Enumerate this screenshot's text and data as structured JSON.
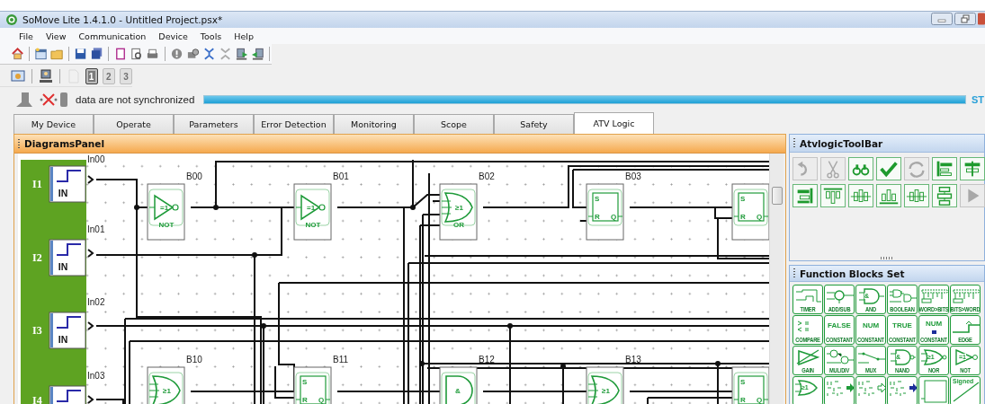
{
  "window": {
    "title": "SoMove Lite 1.4.1.0 - Untitled Project.psx*"
  },
  "menu": [
    "File",
    "View",
    "Communication",
    "Device",
    "Tools",
    "Help"
  ],
  "toolbar_2": [
    {
      "disabled": false
    },
    {
      "disabled": false
    },
    {
      "disabled": true
    },
    {
      "label": "1",
      "selected": true,
      "disabled": false
    },
    {
      "label": "2",
      "selected": false,
      "disabled": true
    },
    {
      "label": "3",
      "selected": false,
      "disabled": true
    }
  ],
  "sync": {
    "connected": false,
    "message": "data are not synchronized",
    "level": 1,
    "status": "ST"
  },
  "tabs": [
    {
      "label": "My Device",
      "selected": false
    },
    {
      "label": "Operate",
      "selected": false
    },
    {
      "label": "Parameters",
      "selected": false
    },
    {
      "label": "Error Detection",
      "selected": false
    },
    {
      "label": "Monitoring",
      "selected": false
    },
    {
      "label": "Scope",
      "selected": false
    },
    {
      "label": "Safety",
      "selected": false
    },
    {
      "label": "ATV Logic",
      "selected": true
    }
  ],
  "diagrams_panel": {
    "title": "DiagramsPanel",
    "inputs": [
      {
        "label": "I1",
        "block": "IN",
        "name": "In00"
      },
      {
        "label": "I2",
        "block": "IN",
        "name": "In01"
      },
      {
        "label": "I3",
        "block": "IN",
        "name": "In02"
      },
      {
        "label": "I4",
        "name": "In03"
      }
    ],
    "block_rows": [
      [
        {
          "id": "B00",
          "kind": "not",
          "symbol": "=1",
          "label": "NOT"
        },
        {
          "id": "B01",
          "kind": "not",
          "symbol": "=1",
          "label": "NOT"
        },
        {
          "id": "B02",
          "kind": "or",
          "symbol": "≥1",
          "label": "OR"
        },
        {
          "id": "B03",
          "kind": "sr",
          "set": "S",
          "reset": "R",
          "output": "Q"
        },
        {
          "kind": "sr",
          "set": "S",
          "reset": "R",
          "output": "Q"
        }
      ],
      [
        {
          "id": "B10",
          "kind": "or",
          "symbol": "≥1"
        },
        {
          "id": "B11",
          "kind": "sr",
          "set": "S",
          "reset": "R",
          "output": "Q"
        },
        {
          "id": "B12",
          "kind": "and",
          "symbol": "&"
        },
        {
          "id": "B13",
          "kind": "or",
          "symbol": "≥1"
        },
        {
          "kind": "sr",
          "set": "S",
          "reset": "R",
          "output": "Q"
        }
      ]
    ]
  },
  "toolbar_panel": {
    "title": "AtvlogicToolBar",
    "tools": [
      {
        "disabled": true
      },
      {
        "disabled": true
      },
      {
        "disabled": false
      },
      {
        "disabled": false
      },
      {
        "disabled": true
      },
      {
        "disabled": false
      },
      {
        "disabled": false
      },
      {
        "disabled": false
      },
      {
        "disabled": false
      },
      {
        "disabled": false
      },
      {
        "disabled": false
      },
      {
        "disabled": false
      },
      {
        "disabled": false
      },
      {
        "disabled": true
      }
    ]
  },
  "function_blocks": {
    "title": "Function Blocks Set",
    "blocks": [
      {
        "kind": "timer",
        "label": "TIMER"
      },
      {
        "kind": "addsub",
        "label": "ADD/SUB"
      },
      {
        "kind": "and",
        "label": "AND",
        "caption": "&"
      },
      {
        "kind": "boolean",
        "label": "BOOLEAN"
      },
      {
        "kind": "wordbits",
        "label": "WORD>BITS"
      },
      {
        "kind": "bitsword",
        "label": "BITS>WORD"
      },
      {
        "kind": "compare",
        "label": "COMPARE"
      },
      {
        "kind": "const",
        "label": "CONSTANT",
        "caption": "FALSE"
      },
      {
        "kind": "const",
        "label": "CONSTANT",
        "caption": "NUM"
      },
      {
        "kind": "const",
        "label": "CONSTANT",
        "caption": "TRUE"
      },
      {
        "kind": "constnum",
        "label": "CONSTANT",
        "caption": "NUM"
      },
      {
        "kind": "edge",
        "label": "EDGE"
      },
      {
        "kind": "gain",
        "label": "GAIN"
      },
      {
        "kind": "muldiv",
        "label": "MUL/DIV"
      },
      {
        "kind": "mux",
        "label": "MUX"
      },
      {
        "kind": "nand",
        "label": "NAND",
        "caption": "&"
      },
      {
        "kind": "nor",
        "label": "NOR",
        "caption": "≥1"
      },
      {
        "kind": "not",
        "label": "NOT",
        "caption": "=1"
      },
      {
        "kind": "or",
        "caption": "≥1"
      },
      {
        "kind": "read"
      },
      {
        "kind": "read2"
      },
      {
        "kind": "read3"
      },
      {
        "kind": "sr"
      },
      {
        "kind": "signed",
        "caption": "Signed"
      }
    ]
  }
}
